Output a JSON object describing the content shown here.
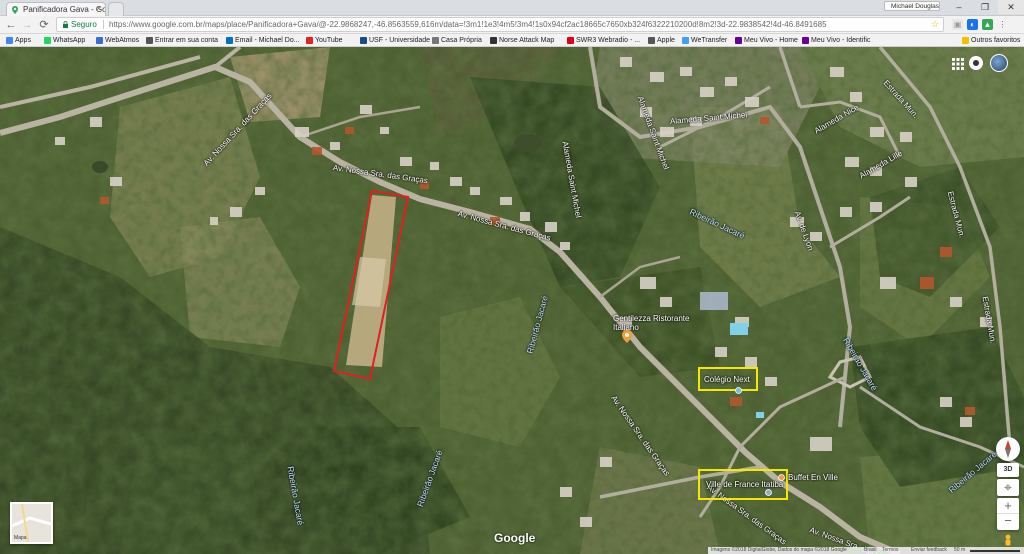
{
  "browser": {
    "tabs": [
      {
        "title": "Panificadora Gava - Goo",
        "active": true
      },
      {
        "title": "",
        "active": false
      }
    ],
    "user_name": "Michael Douglas",
    "address": {
      "secure_label": "Seguro",
      "url": "https://www.google.com.br/maps/place/Panificadora+Gava/@-22.9868247,-46.8563559,616m/data=!3m1!1e3!4m5!3m4!1s0x94cf2ac18665c7650xb324f6322210200d!8m2!3d-22.9838542!4d-46.8491685"
    },
    "bookmarks": [
      {
        "label": "Apps",
        "color": "#4285f4"
      },
      {
        "label": "WhatsApp",
        "color": "#25d366"
      },
      {
        "label": "WebAtmos",
        "color": "#3b6ed1"
      },
      {
        "label": "Entrar em sua conta",
        "color": "#555555"
      },
      {
        "label": "Email - Michael Do...",
        "color": "#0072c6"
      },
      {
        "label": "YouTube",
        "color": "#e62117"
      },
      {
        "label": "USF - Universidade",
        "color": "#1a4a8a"
      },
      {
        "label": "Casa Própria",
        "color": "#777777"
      },
      {
        "label": "Norse Attack Map",
        "color": "#333333"
      },
      {
        "label": "SWR3 Webradio - ...",
        "color": "#e3001b"
      },
      {
        "label": "Apple",
        "color": "#555555"
      },
      {
        "label": "WeTransfer",
        "color": "#409fff"
      },
      {
        "label": "Meu Vivo - Home",
        "color": "#660099"
      },
      {
        "label": "Meu Vivo - Identific",
        "color": "#660099"
      },
      {
        "label": "Outros favoritos",
        "color": "#f2c200"
      }
    ]
  },
  "map": {
    "road_labels": [
      "Av. Nossa Sra. das Graças",
      "Av. Nossa Sra. das Graças",
      "Av. Nossa Sra. das Graças",
      "Av. Nossa Sra. das Graças",
      "Av. Nossa Sra. das Graças",
      "Alameda Saint Michel",
      "Alameda Saint Michel",
      "Alameda Nice",
      "Alameda Nice",
      "Alameda Lille",
      "Av. de Lyon",
      "Estrada Mun.",
      "Estrada Mun."
    ],
    "water_labels": [
      "Ribeirão Jacaré",
      "Ribeirão Jacaré",
      "Ribeirão Jacaré",
      "Ribeirão Jacaré",
      "Ribeirão Jacaré",
      "Ribeirão Jacaré"
    ],
    "poi_labels": {
      "restaurant": "Gentilezza Ristorante Italiano",
      "colegio": "Colégio Next",
      "ville": "Ville de France Itatiba",
      "buffet": "Buffet En Ville"
    },
    "google_logo": "Google",
    "minimap_label": "Mapa",
    "footer": {
      "imagery": "Imagens ©2018 DigitalGlobe, Dados do mapa ©2018 Google",
      "country": "Brasil",
      "terms": "Termos",
      "feedback": "Enviar feedback",
      "scale": "50 m"
    },
    "pegman_label": "3D",
    "colors": {
      "highlight": "#f4e800",
      "parcel": "#e02020"
    }
  }
}
